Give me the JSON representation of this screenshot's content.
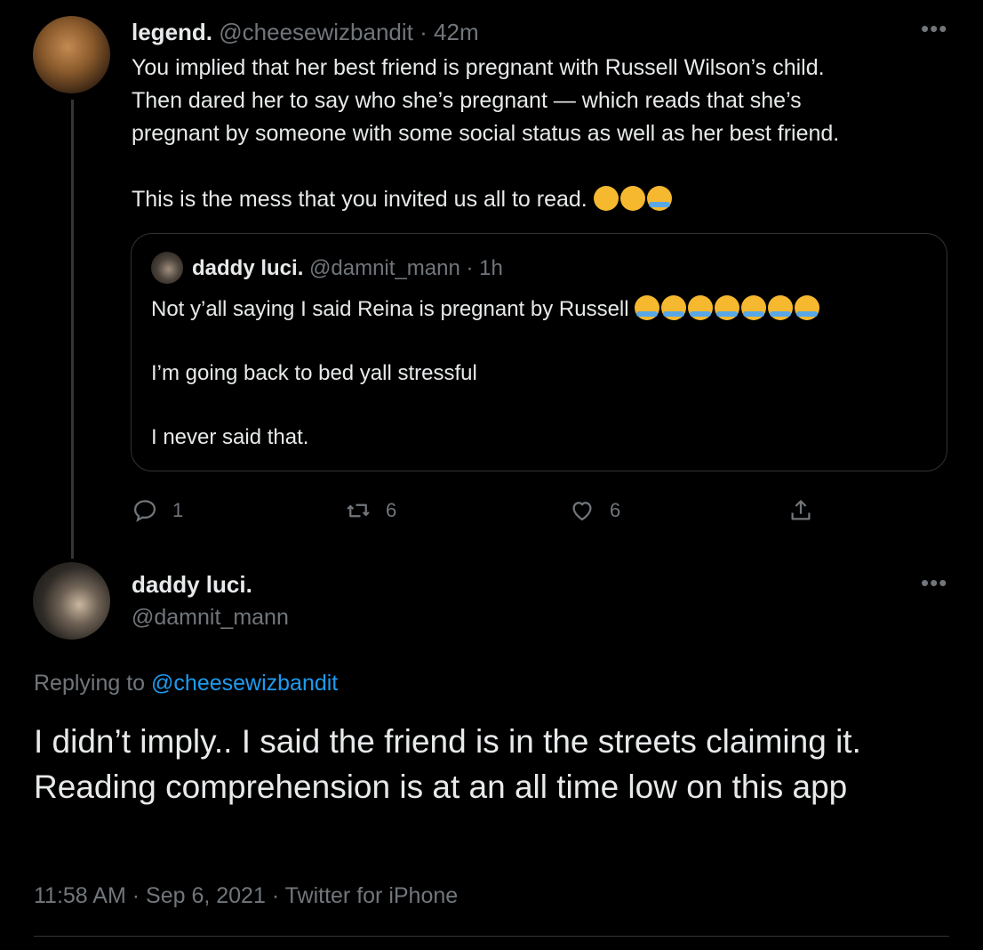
{
  "parent_tweet": {
    "display_name": "legend.",
    "handle": "@cheesewizbandit",
    "separator": "·",
    "time_ago": "42m",
    "text": "You implied that her best friend is pregnant with Russell Wilson’s child.\nThen dared her to say who she’s pregnant — which reads that she’s\npregnant by someone with some social status as well as her best friend.\n\nThis is the mess that you invited us all to read.",
    "emojis": [
      "confounded-face-emoji",
      "woozy-face-emoji",
      "tears-of-joy-emoji"
    ],
    "quoted_tweet": {
      "display_name": "daddy luci.",
      "handle": "@damnit_mann",
      "separator": "·",
      "time_ago": "1h",
      "line1": "Not y’all saying I said Reina is pregnant by Russell",
      "line1_emojis": [
        "tears-of-joy-emoji",
        "tears-of-joy-emoji",
        "tears-of-joy-emoji",
        "loudly-crying-emoji",
        "loudly-crying-emoji",
        "loudly-crying-emoji",
        "loudly-crying-emoji"
      ],
      "rest": "\nI’m going back to bed yall stressful\n\nI never said that."
    },
    "actions": {
      "reply_count": "1",
      "retweet_count": "6",
      "like_count": "6"
    }
  },
  "main_tweet": {
    "display_name": "daddy luci.",
    "handle": "@damnit_mann",
    "replying_prefix": "Replying to",
    "replying_to": "@cheesewizbandit",
    "text": "I didn’t imply.. I said the friend is in the streets claiming it. Reading comprehension is at an all time low on this app",
    "time": "11:58 AM",
    "date": "Sep 6, 2021",
    "source": "Twitter for iPhone",
    "separator": "·"
  },
  "more_glyph": "•••",
  "colors": {
    "background": "#000000",
    "text": "#e7e9ea",
    "muted": "#71767b",
    "link": "#1d9bf0",
    "border": "#2f3336"
  }
}
